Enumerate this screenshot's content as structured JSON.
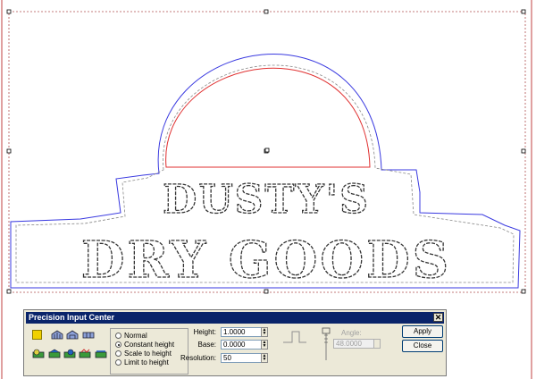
{
  "dialog": {
    "title": "Precision Input Center",
    "close_label": "✕",
    "modes": {
      "options": [
        "Normal",
        "Constant height",
        "Scale to height",
        "Limit to height"
      ],
      "selected": "Constant height"
    },
    "fields": {
      "height_label": "Height:",
      "height_value": "1.0000",
      "base_label": "Base:",
      "base_value": "0.0000",
      "resolution_label": "Resolution:",
      "resolution_value": "50"
    },
    "angle": {
      "label": "Angle:",
      "value": "48.0000"
    },
    "apply_label": "Apply",
    "close_button_label": "Close"
  },
  "artwork": {
    "line1": "DUSTY'S",
    "line2": "DRY GOODS"
  },
  "colors": {
    "outline_blue": "#3a3ae0",
    "arc_red": "#e03030",
    "dialog_title_bg": "#0a246a",
    "selection_frame": "#a03030"
  }
}
